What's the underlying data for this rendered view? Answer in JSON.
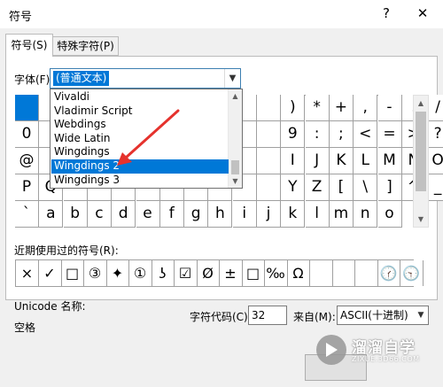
{
  "dialog": {
    "title": "符号",
    "help_label": "?",
    "close_label": "✕"
  },
  "tabs": [
    {
      "label": "符号(S)"
    },
    {
      "label": "特殊字符(P)"
    }
  ],
  "font": {
    "label": "字体(F):",
    "value": "(普通文本)"
  },
  "font_dropdown": {
    "items": [
      "Vivaldi",
      "Vladimir Script",
      "Webdings",
      "Wide Latin",
      "Wingdings",
      "Wingdings 2",
      "Wingdings 3"
    ],
    "selected": "Wingdings 2"
  },
  "symbol_grid": {
    "rows": [
      [
        "",
        "",
        "",
        "",
        "",
        "",
        "",
        "",
        "",
        "",
        "",
        ")",
        "*",
        "+",
        ",",
        "-",
        ".",
        "/"
      ],
      [
        "0",
        "",
        "",
        "",
        "",
        "",
        "",
        "",
        "",
        "",
        "",
        "9",
        ":",
        ";",
        "<",
        "=",
        ">",
        "?"
      ],
      [
        "@",
        "",
        "",
        "",
        "",
        "",
        "",
        "",
        "",
        "",
        "",
        "I",
        "J",
        "K",
        "L",
        "M",
        "N",
        "O"
      ],
      [
        "P",
        "Q",
        "",
        "",
        "",
        "",
        "",
        "",
        "",
        "",
        "",
        "Y",
        "Z",
        "[",
        "\\",
        "]",
        "^",
        "_"
      ],
      [
        "`",
        "a",
        "b",
        "c",
        "d",
        "e",
        "f",
        "g",
        "h",
        "i",
        "j",
        "k",
        "l",
        "m",
        "n",
        "o"
      ]
    ]
  },
  "recent": {
    "label": "近期使用过的符号(R):",
    "symbols": [
      "×",
      "✓",
      "□",
      "③",
      "✦",
      "①",
      "ʖ",
      "☑",
      "Ø",
      "±",
      "□",
      "‰",
      "Ω",
      "",
      "",
      "",
      "🕜",
      "🕤"
    ]
  },
  "unicode": {
    "name_label": "Unicode 名称:",
    "name_value": "空格"
  },
  "charcode": {
    "label": "字符代码(C):",
    "value": "32"
  },
  "from": {
    "label": "来自(M):",
    "value": "ASCII(十进制)"
  },
  "watermark": {
    "text": "溜溜自学",
    "sub": "ZIXUE.3D66.COM"
  },
  "colors": {
    "accent": "#0078d7",
    "pointer": "#e5322d"
  }
}
